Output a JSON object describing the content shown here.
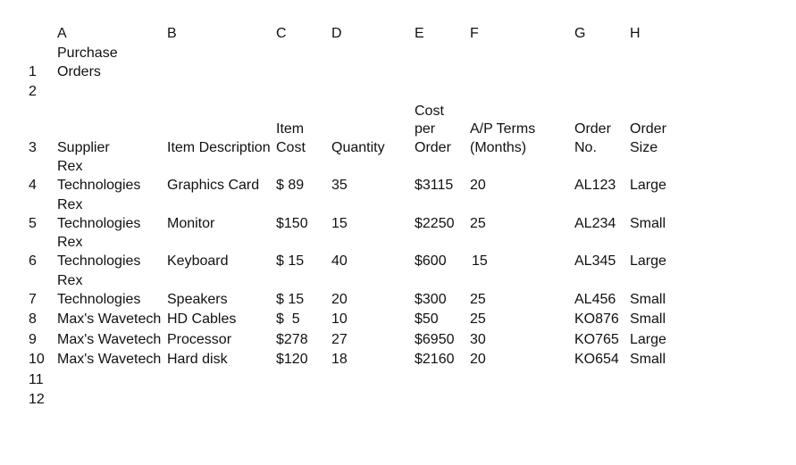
{
  "columns": [
    "A",
    "B",
    "C",
    "D",
    "E",
    "F",
    "G",
    "H"
  ],
  "row_numbers": [
    "1",
    "2",
    "3",
    "4",
    "5",
    "6",
    "7",
    "8",
    "9",
    "10",
    "11",
    "12"
  ],
  "title": [
    "Purchase",
    "Orders"
  ],
  "headers": {
    "supplier": [
      "Supplier"
    ],
    "item_description": [
      "Item Description"
    ],
    "item_cost": [
      "Item",
      "Cost"
    ],
    "quantity": [
      "Quantity"
    ],
    "cost_per_order": [
      "Cost",
      "per",
      "Order"
    ],
    "ap_terms": [
      "A/P Terms",
      "(Months)"
    ],
    "order_no": [
      "Order",
      "No."
    ],
    "order_size": [
      "Order",
      "Size"
    ]
  },
  "rows": [
    {
      "supplier": [
        "Rex",
        "Technologies"
      ],
      "item": "Graphics Card",
      "cost": "$ 89",
      "qty": "35",
      "cost_per_order": "$3115",
      "terms": "20",
      "order_no": "AL123",
      "size": "Large"
    },
    {
      "supplier": [
        "Rex",
        "Technologies"
      ],
      "item": "Monitor",
      "cost": "$150",
      "qty": "15",
      "cost_per_order": "$2250",
      "terms": "25",
      "order_no": "AL234",
      "size": "Small"
    },
    {
      "supplier": [
        "Rex",
        "Technologies"
      ],
      "item": "Keyboard",
      "cost": "$ 15",
      "qty": "40",
      "cost_per_order": "$600",
      "terms": "15",
      "order_no": "AL345",
      "size": "Large"
    },
    {
      "supplier": [
        "Rex",
        "Technologies"
      ],
      "item": "Speakers",
      "cost": "$ 15",
      "qty": "20",
      "cost_per_order": "$300",
      "terms": "25",
      "order_no": "AL456",
      "size": "Small"
    },
    {
      "supplier": [
        "Max's Wavetech"
      ],
      "item": "HD Cables",
      "cost": "$  5",
      "qty": "10",
      "cost_per_order": "$50",
      "terms": "25",
      "order_no": "KO876",
      "size": "Small"
    },
    {
      "supplier": [
        "Max's Wavetech"
      ],
      "item": "Processor",
      "cost": "$278",
      "qty": "27",
      "cost_per_order": "$6950",
      "terms": "30",
      "order_no": "KO765",
      "size": "Large"
    },
    {
      "supplier": [
        "Max's Wavetech"
      ],
      "item": "Hard disk",
      "cost": "$120",
      "qty": "18",
      "cost_per_order": "$2160",
      "terms": "20",
      "order_no": "KO654",
      "size": "Small"
    }
  ]
}
